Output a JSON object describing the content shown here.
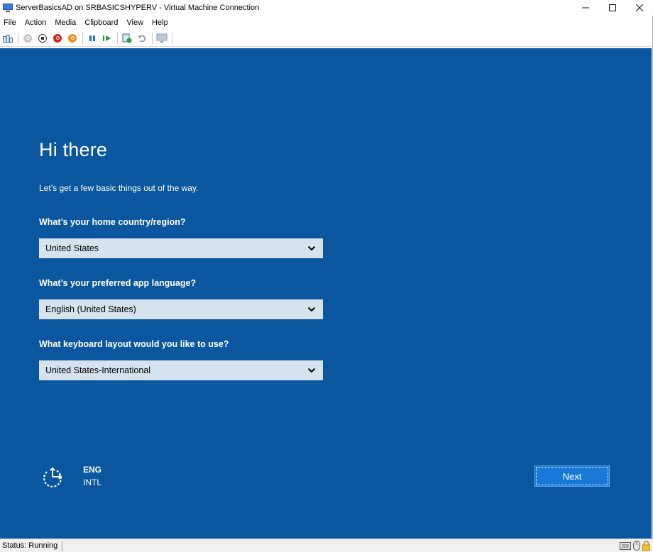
{
  "window": {
    "title": "ServerBasicsAD on SRBASICSHYPERV - Virtual Machine Connection",
    "controls": {
      "minimize": "—",
      "maximize": "☐",
      "close": "✕"
    }
  },
  "menu": [
    "File",
    "Action",
    "Media",
    "Clipboard",
    "View",
    "Help"
  ],
  "toolbar": {
    "icons": [
      "ctrl-alt-del-icon",
      "start-icon",
      "turn-off-icon",
      "shut-down-icon",
      "save-icon",
      "pause-icon",
      "resume-icon",
      "checkpoint-icon",
      "revert-icon",
      "enhanced-session-icon"
    ]
  },
  "setup": {
    "heading": "Hi there",
    "subtext": "Let’s get a few basic things out of the way.",
    "country_label": "What’s your home country/region?",
    "country_value": "United States",
    "language_label": "What’s your preferred app language?",
    "language_value": "English (United States)",
    "keyboard_label": "What keyboard layout would you like to use?",
    "keyboard_value": "United States-International",
    "lang_code": "ENG",
    "lang_layout": "INTL",
    "next_label": "Next"
  },
  "status": {
    "text": "Status: Running",
    "icons": [
      "keyboard-icon",
      "mouse-icon",
      "lock-icon"
    ]
  },
  "colors": {
    "vm_background": "#0a57a0",
    "select_background": "#d6e2ee",
    "next_button": "#1979d9"
  }
}
